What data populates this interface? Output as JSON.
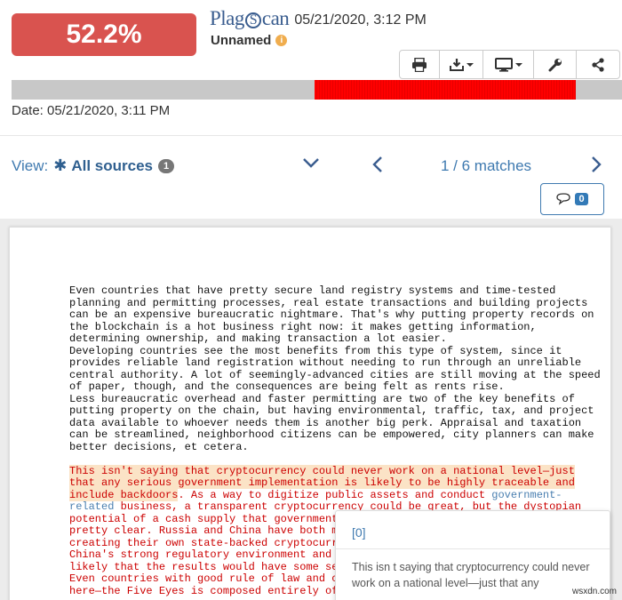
{
  "header": {
    "score": "52.2%",
    "brand": {
      "pre": "Plag",
      "s": "S",
      "post": "can"
    },
    "timestamp": "05/21/2020, 3:12 PM",
    "doc_name": "Unnamed",
    "info_icon": "i"
  },
  "toolbar": {
    "icons": [
      "print-icon",
      "download-icon",
      "monitor-icon",
      "wrench-icon",
      "share-icon"
    ]
  },
  "match_bar": {
    "match_segments": [
      {
        "start": 0.497,
        "end": 0.925
      }
    ],
    "colors": {
      "track": "#c8c8c8",
      "match": "#ff0000"
    }
  },
  "date_line": "Date: 05/21/2020, 3:11 PM",
  "view": {
    "label": "View:",
    "asterisk": "✱",
    "sources": "All sources",
    "count": "1"
  },
  "pager": {
    "text": "1 / 6 matches"
  },
  "comments": {
    "count": "0"
  },
  "document": {
    "p1": "Even countries that have pretty secure land registry systems and time-tested\nplanning and permitting processes, real estate transactions and building projects\ncan be an expensive bureaucratic nightmare. That's why putting property records on\nthe blockchain is a hot business right now: it makes getting information,\ndetermining ownership, and making transaction a lot easier.\nDeveloping countries see the most benefits from this type of system, since it\nprovides reliable land registration without needing to run through an unreliable\ncentral authority. A lot of seemingly-advanced cities are still moving at the speed\nof paper, though, and the consequences are being felt as rents rise.\nLess bureaucratic overhead and faster permitting are two of the key benefits of\nputting property on the chain, but having environmental, traffic, tax, and project\ndata available to whoever needs them is another big perk. Appraisal and taxation\ncan be streamlined, neighborhood citizens can be empowered, city planners can make\nbetter decisions, et cetera.",
    "hl1": "This isn't saying that cryptocurrency could never work on a national level—just",
    "hl2": "that any serious government implementation is likely to be highly traceable and",
    "hl3": "include backdoors",
    "r3a": ". As a way to digitize public assets and conduct ",
    "r3b": "government-",
    "r4a": "related",
    "r4b": " business, a transparent cryptocurrency could be great, but the dystopian",
    "r5": "potential of a cash supply that governments",
    "r6": "pretty clear. Russia and China have both ma",
    "r7": "creating their own state-backed cryptocurre",
    "r8": "China's strong regulatory environment and p",
    "r9": "likely that the results would have some sev",
    "r10": "Even countries with good rule of law and ci",
    "r11": "here—the Five Eyes is composed entirely of"
  },
  "tooltip": {
    "head": "[0]",
    "body": "This isn t saying that cryptocurrency could never work on a national level—just that any"
  },
  "watermark": "wsxdn.com"
}
